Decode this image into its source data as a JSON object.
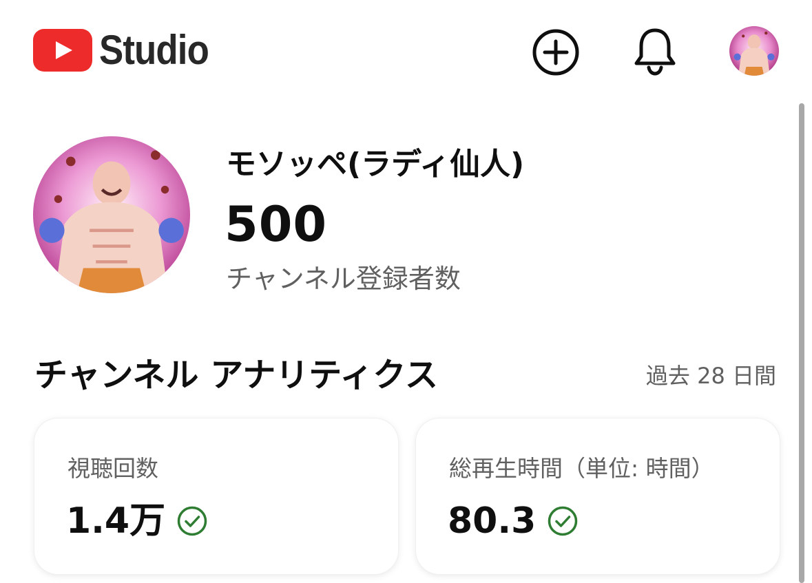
{
  "header": {
    "logo_text": "Studio",
    "icons": [
      "youtube-play-icon",
      "create-plus-icon",
      "bell-icon",
      "avatar"
    ]
  },
  "channel": {
    "name": "モソッペ(ラディ仙人)",
    "subscriber_count": "500",
    "subscriber_label": "チャンネル登録者数"
  },
  "analytics": {
    "title": "チャンネル アナリティクス",
    "period": "過去 28 日間",
    "cards": [
      {
        "label": "視聴回数",
        "value": "1.4万",
        "status_icon": "check-circle-icon"
      },
      {
        "label": "総再生時間（単位: 時間）",
        "value": "80.3",
        "status_icon": "check-circle-icon"
      }
    ]
  },
  "colors": {
    "brand_red": "#ee2b2b",
    "check_green": "#2e7d32",
    "secondary_text": "#606060"
  }
}
